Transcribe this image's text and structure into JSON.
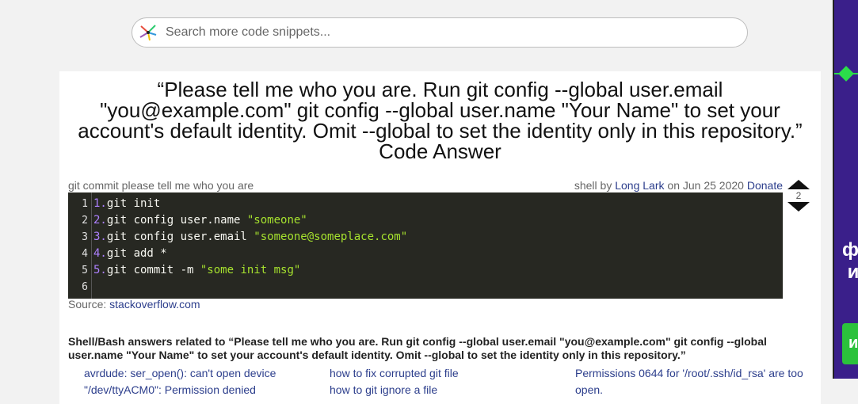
{
  "search": {
    "placeholder": "Search more code snippets..."
  },
  "page": {
    "title": "“Please tell me who you are. Run git config --global user.email \"you@example.com\" git config --global user.name \"Your Name\" to set your account's default identity. Omit --global to set the identity only in this repository.” Code Answer"
  },
  "snippet": {
    "label": "git commit please tell me who you are",
    "lang": "shell",
    "by": "by",
    "author": "Long Lark",
    "on": "on",
    "date": "Jun 25 2020",
    "donate": "Donate",
    "votes": "2",
    "source_label": "Source:",
    "source_link": "stackoverflow.com",
    "line_numbers": [
      "1",
      "2",
      "3",
      "4",
      "5",
      "6"
    ],
    "lines": [
      {
        "num": "1.",
        "code": "git init",
        "str": ""
      },
      {
        "num": "2.",
        "code": "git config user.name ",
        "str": "\"someone\""
      },
      {
        "num": "3.",
        "code": "git config user.email ",
        "str": "\"someone@someplace.com\""
      },
      {
        "num": "4.",
        "code": "git add *",
        "str": ""
      },
      {
        "num": "5.",
        "code": "git commit -m ",
        "str": "\"some init msg\""
      },
      {
        "num": "",
        "code": "",
        "str": ""
      }
    ]
  },
  "related": {
    "title": "Shell/Bash answers related to “Please tell me who you are. Run git config --global user.email \"you@example.com\" git config --global user.name \"Your Name\" to set your account's default identity. Omit --global to set the identity only in this repository.”",
    "columns": [
      [
        "avrdude: ser_open(): can't open device \"/dev/ttyACM0\": Permission denied"
      ],
      [
        "how to fix corrupted git file",
        "how to git ignore a file"
      ],
      [
        "Permissions 0644 for '/root/.ssh/id_rsa' are too open."
      ]
    ]
  },
  "ad": {
    "text": "ф\n и",
    "button": "и"
  },
  "colors": {
    "code_bg": "#272822",
    "string": "#a6e22e",
    "line_number": "#ae81ff",
    "link": "#2c3e8c",
    "ad_bg": "#3a1f8a",
    "ad_accent": "#2bdc4a"
  }
}
